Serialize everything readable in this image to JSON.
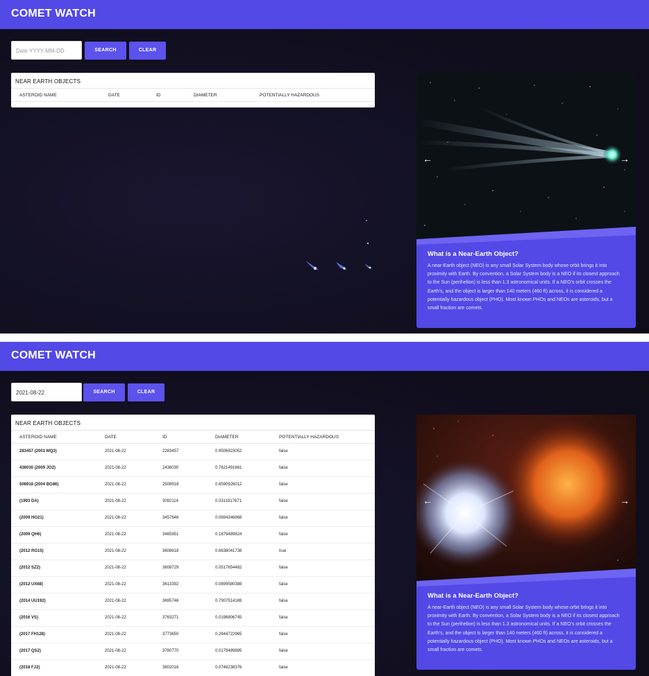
{
  "screen1": {
    "header": {
      "title": "COMET WATCH"
    },
    "search": {
      "placeholder": "Date YYYY-MM-DD",
      "value": "",
      "search_label": "SEARCH",
      "clear_label": "CLEAR"
    },
    "table": {
      "title": "NEAR EARTH OBJECTS",
      "columns": [
        "ASTEROID NAME",
        "DATE",
        "ID",
        "DIAMETER",
        "POTENTIALLY HAZARDOUS"
      ],
      "rows": []
    },
    "card": {
      "title": "What is a Near-Earth Object?",
      "text": "A near-Earth object (NEO) is any small Solar System body whose orbit brings it into proximity with Earth. By convention, a Solar System body is a NEO if its closest approach to the Sun (perihelion) is less than 1.3 astronomical units. If a NEO's orbit crosses the Earth's, and the object is larger than 140 meters (460 ft) across, it is considered a potentially hazardous object (PHO). Most known PHOs and NEOs are asteroids, but a small fraction are comets.",
      "prev_icon": "arrow-left-icon",
      "next_icon": "arrow-right-icon",
      "prev_glyph": "←",
      "next_glyph": "→",
      "image": "comet-image"
    }
  },
  "screen2": {
    "header": {
      "title": "COMET WATCH"
    },
    "search": {
      "placeholder": "Date YYYY-MM-DD",
      "value": "2021-08-22",
      "search_label": "SEARCH",
      "clear_label": "CLEAR"
    },
    "table": {
      "title": "NEAR EARTH OBJECTS",
      "columns": [
        "ASTEROID NAME",
        "DATE",
        "ID",
        "DIAMETER",
        "POTENTIALLY HAZARDOUS"
      ],
      "rows": [
        [
          "283457 (2001 MQ3)",
          "2021-08-22",
          "2283457",
          "0.9506923052",
          "false"
        ],
        [
          "436030 (2009 JO2)",
          "2021-08-22",
          "2436030",
          "0.7621491661",
          "false"
        ],
        [
          "508918 (2004 BG86)",
          "2021-08-22",
          "2508918",
          "0.6590926012",
          "false"
        ],
        [
          "(1993 DA)",
          "2021-08-22",
          "3092114",
          "0.0311917671",
          "false"
        ],
        [
          "(2009 HG21)",
          "2021-08-22",
          "3457846",
          "0.0694346868",
          "false"
        ],
        [
          "(2009 QH6)",
          "2021-08-22",
          "3465951",
          "0.1879489824",
          "false"
        ],
        [
          "(2012 RG15)",
          "2021-08-22",
          "3608618",
          "0.6638041738",
          "true"
        ],
        [
          "(2012 SZ2)",
          "2021-08-22",
          "3608729",
          "0.0517654482",
          "false"
        ],
        [
          "(2012 UX68)",
          "2021-08-22",
          "3613392",
          "0.0899580388",
          "false"
        ],
        [
          "(2014 UU192)",
          "2021-08-22",
          "3695746",
          "0.7907514169",
          "false"
        ],
        [
          "(2016 VS)",
          "2021-08-22",
          "3763271",
          "0.0196806745",
          "false"
        ],
        [
          "(2017 FH128)",
          "2021-08-22",
          "3773650",
          "0.2844722965",
          "false"
        ],
        [
          "(2017 QS2)",
          "2021-08-22",
          "3780770",
          "0.0179489885",
          "false"
        ],
        [
          "(2018 FJ2)",
          "2021-08-22",
          "3802016",
          "0.0748238376",
          "false"
        ]
      ]
    },
    "card": {
      "title": "What is a Near-Earth Object?",
      "text": "A near-Earth object (NEO) is any small Solar System body whose orbit brings it into proximity with Earth. By convention, a Solar System body is a NEO if its closest approach to the Sun (perihelion) is less than 1.3 astronomical units. If a NEO's orbit crosses the Earth's, and the object is larger than 140 meters (460 ft) across, it is considered a potentially hazardous object (PHO). Most known PHOs and NEOs are asteroids, but a small fraction are comets.",
      "prev_icon": "arrow-left-icon",
      "next_icon": "arrow-right-icon",
      "prev_glyph": "←",
      "next_glyph": "→",
      "image": "supernova-image"
    }
  },
  "colors": {
    "brand": "#5249e6",
    "button": "#5c52ec",
    "background": "#121022"
  }
}
